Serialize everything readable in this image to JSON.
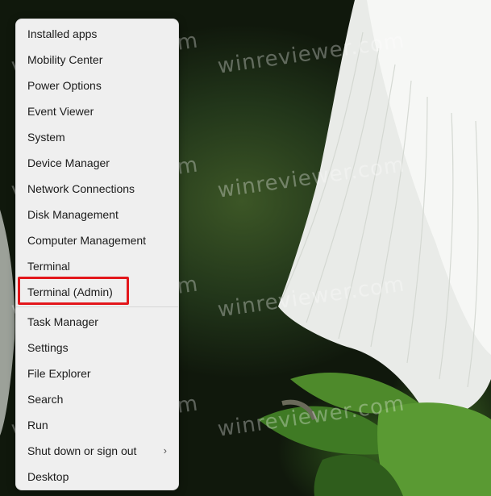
{
  "menu": {
    "items": [
      {
        "label": "Installed apps"
      },
      {
        "label": "Mobility Center"
      },
      {
        "label": "Power Options"
      },
      {
        "label": "Event Viewer"
      },
      {
        "label": "System"
      },
      {
        "label": "Device Manager"
      },
      {
        "label": "Network Connections"
      },
      {
        "label": "Disk Management"
      },
      {
        "label": "Computer Management"
      },
      {
        "label": "Terminal"
      },
      {
        "label": "Terminal (Admin)"
      },
      {
        "label": "Task Manager"
      },
      {
        "label": "Settings"
      },
      {
        "label": "File Explorer"
      },
      {
        "label": "Search"
      },
      {
        "label": "Run"
      },
      {
        "label": "Shut down or sign out"
      },
      {
        "label": "Desktop"
      }
    ],
    "submenu_indicator": "›"
  },
  "highlight": {
    "target": "Terminal (Admin)",
    "color": "#e3161b"
  },
  "watermark": {
    "text": "winreviewer.com"
  },
  "colors": {
    "menu_background": "#efefef",
    "text": "#1b1b1b"
  }
}
